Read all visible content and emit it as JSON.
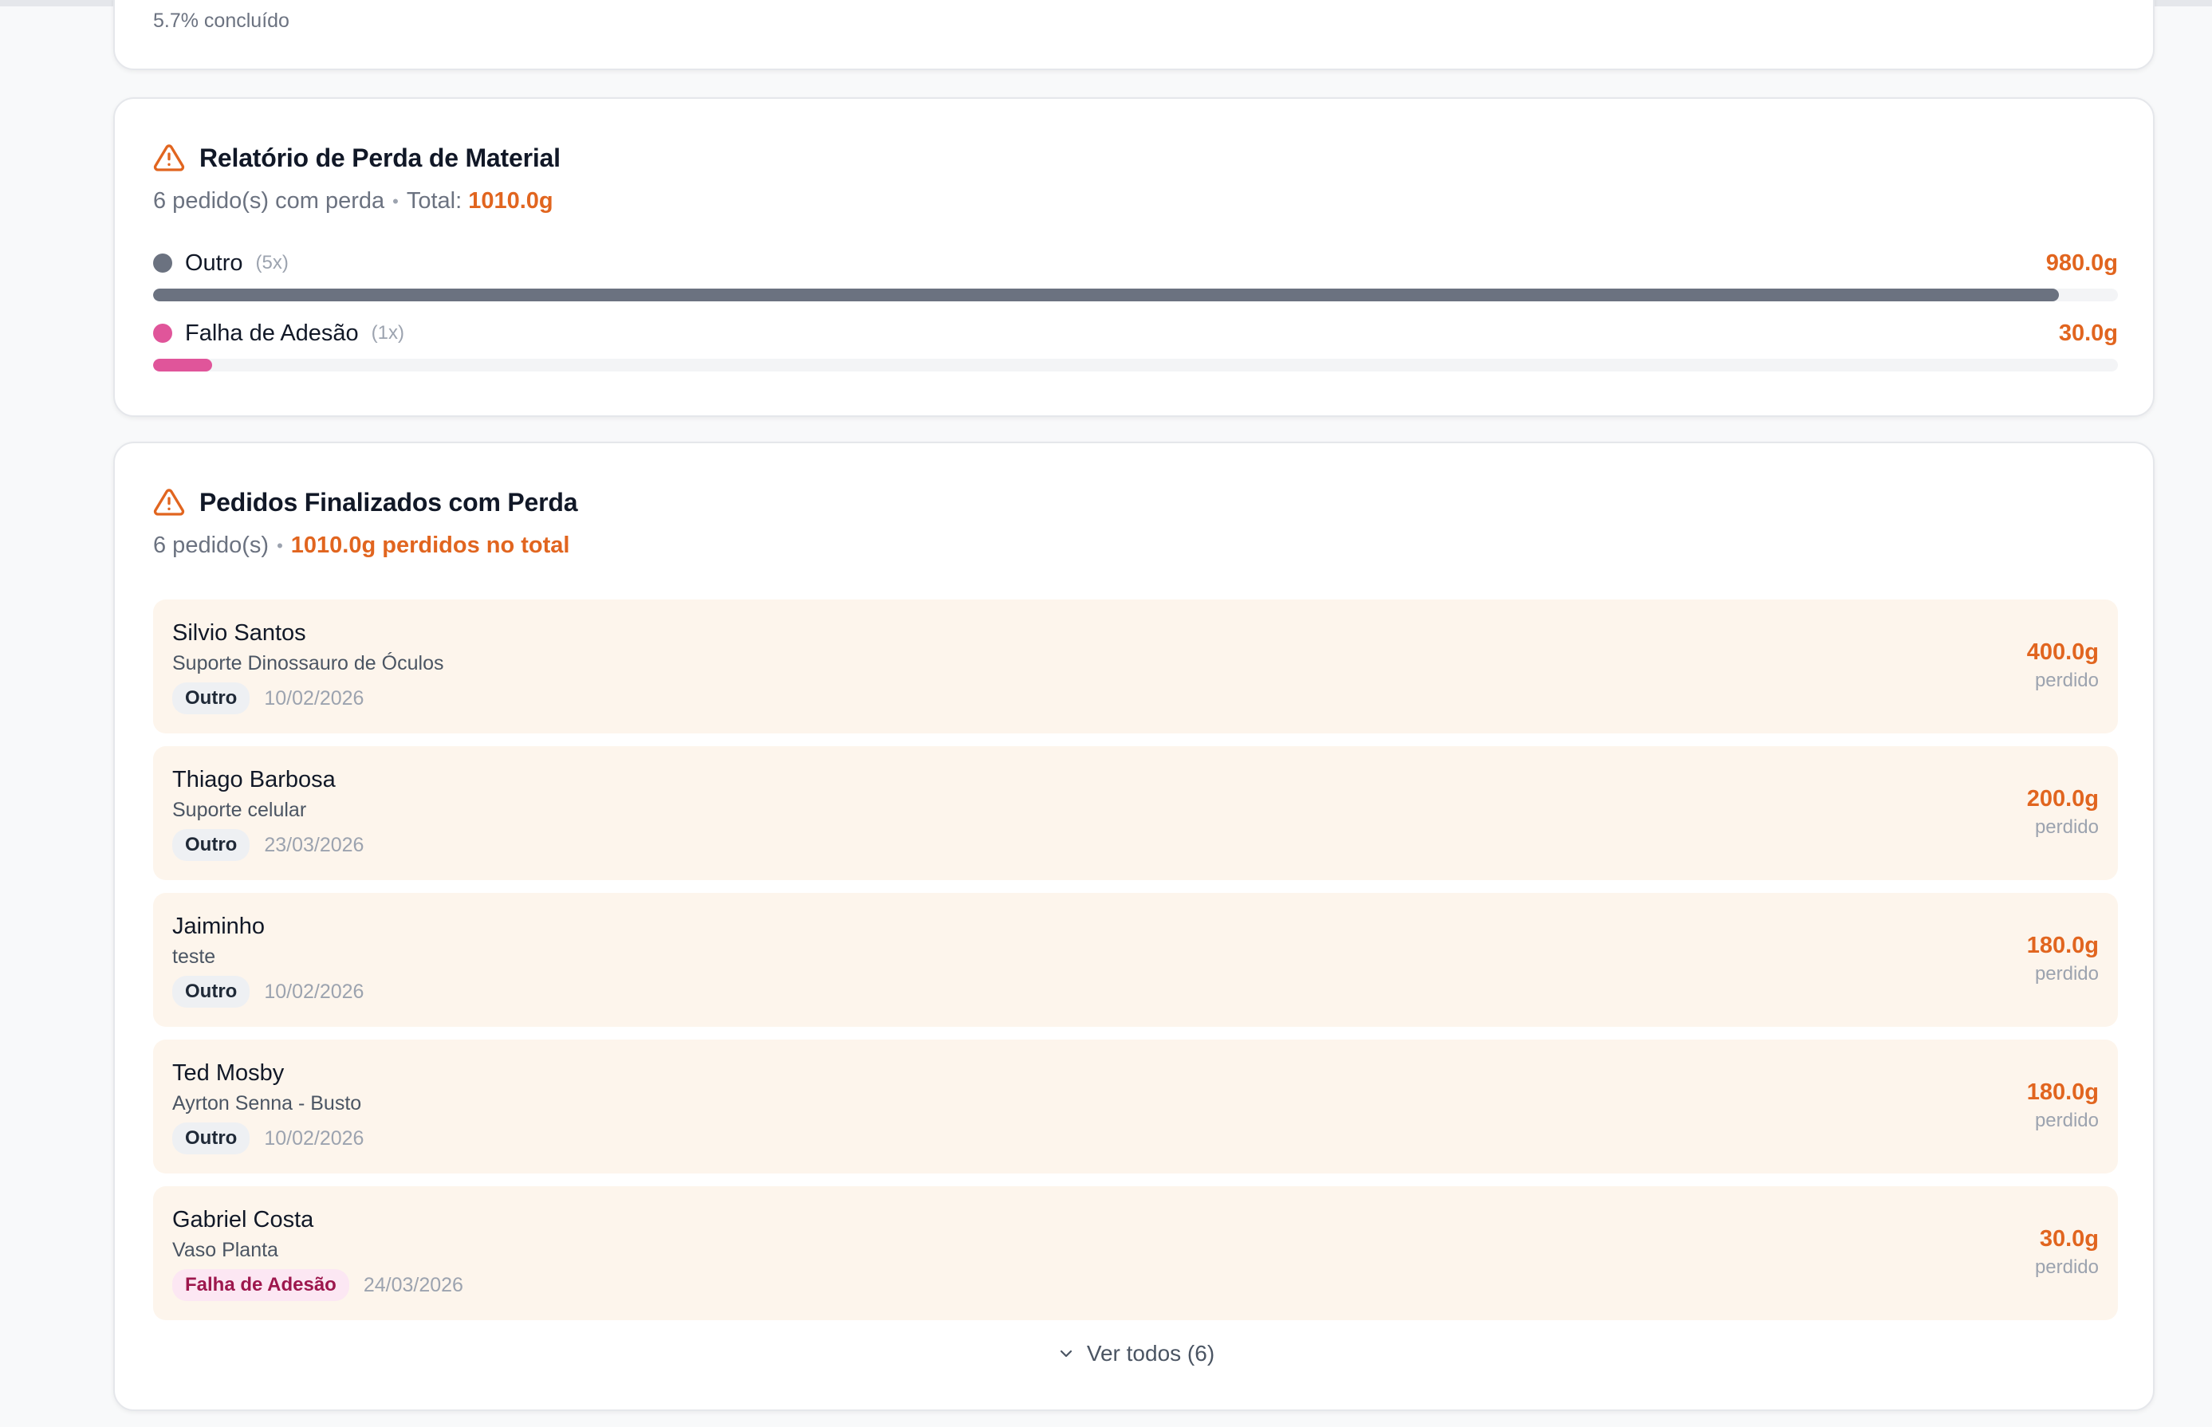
{
  "progress": {
    "text": "5.7% concluído"
  },
  "loss_report": {
    "title": "Relatório de Perda de Material",
    "summary_count": "6 pedido(s) com perda",
    "summary_total_label": "Total:",
    "summary_total_value": "1010.0g",
    "rows": [
      {
        "name": "Outro",
        "count": "(5x)",
        "amount": "980.0g",
        "fraction": 0.97,
        "color": "#6b7280"
      },
      {
        "name": "Falha de Adesão",
        "count": "(1x)",
        "amount": "30.0g",
        "fraction": 0.03,
        "color": "#e0559a"
      }
    ]
  },
  "orders": {
    "title": "Pedidos Finalizados com Perda",
    "summary_count": "6 pedido(s)",
    "summary_total": "1010.0g perdidos no total",
    "lost_label": "perdido",
    "items": [
      {
        "customer": "Silvio Santos",
        "product": "Suporte Dinossauro de Óculos",
        "reason": "Outro",
        "date": "10/02/2026",
        "amount": "400.0g"
      },
      {
        "customer": "Thiago Barbosa",
        "product": "Suporte celular",
        "reason": "Outro",
        "date": "23/03/2026",
        "amount": "200.0g"
      },
      {
        "customer": "Jaiminho",
        "product": "teste",
        "reason": "Outro",
        "date": "10/02/2026",
        "amount": "180.0g"
      },
      {
        "customer": "Ted Mosby",
        "product": "Ayrton Senna - Busto",
        "reason": "Outro",
        "date": "10/02/2026",
        "amount": "180.0g"
      },
      {
        "customer": "Gabriel Costa",
        "product": "Vaso Planta",
        "reason": "Falha de Adesão",
        "date": "24/03/2026",
        "amount": "30.0g"
      }
    ],
    "see_all_label": "Ver todos (6)"
  },
  "icons": {
    "warning": "warning-triangle-icon",
    "chevron": "chevron-down-icon"
  },
  "colors": {
    "accent": "#e1651f",
    "outro": "#6b7280",
    "adesao": "#e0559a",
    "item_bg": "#fdf5ec"
  }
}
